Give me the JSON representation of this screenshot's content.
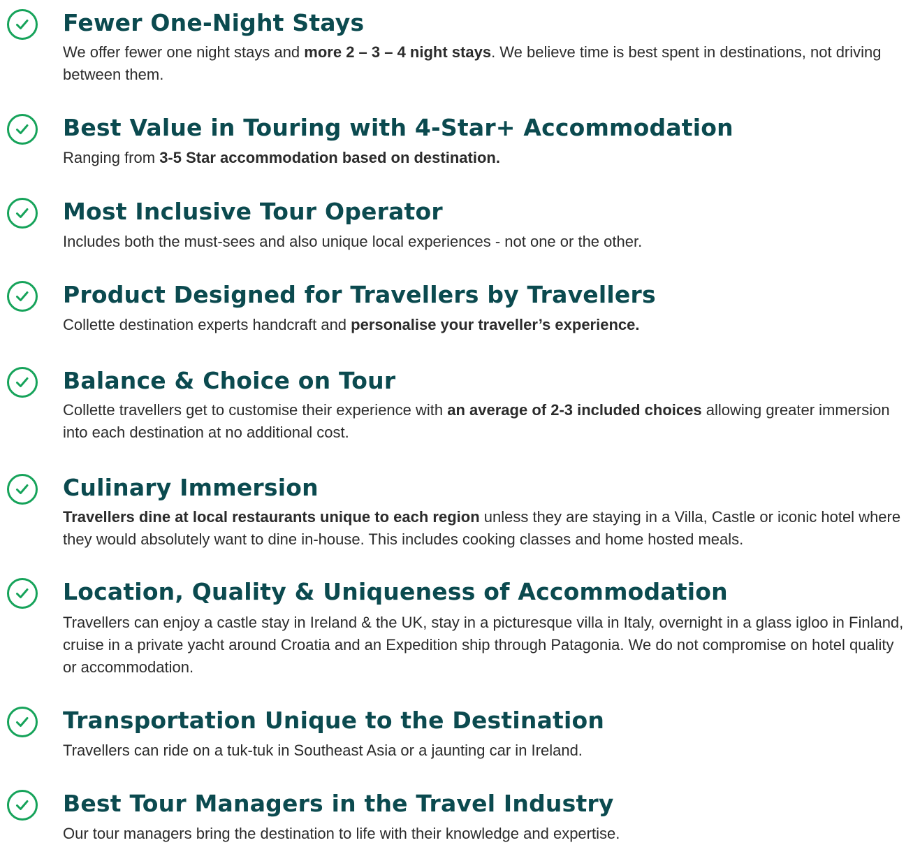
{
  "accent_color": "#16a35a",
  "heading_color": "#0b4a4f",
  "text_color": "#2b2b2b",
  "icon": "check-circle-icon",
  "items": [
    {
      "title": "Fewer One-Night Stays",
      "desc": [
        {
          "t": "We offer fewer one night stays and "
        },
        {
          "t": "more 2 – 3 – 4 night stays",
          "b": true
        },
        {
          "t": ". We believe time is best spent in destinations, not driving between them."
        }
      ]
    },
    {
      "title": "Best Value in Touring with 4-Star+ Accommodation",
      "desc": [
        {
          "t": "Ranging from "
        },
        {
          "t": "3-5 Star accommodation based on destination.",
          "b": true
        }
      ]
    },
    {
      "title": "Most Inclusive Tour Operator",
      "desc": [
        {
          "t": "Includes both the must-sees and also unique local experiences - not one or the other."
        }
      ]
    },
    {
      "title": "Product Designed for Travellers by Travellers",
      "desc": [
        {
          "t": "Collette destination experts handcraft and "
        },
        {
          "t": "personalise your traveller’s experience.",
          "b": true
        }
      ]
    },
    {
      "title": "Balance & Choice on Tour",
      "desc": [
        {
          "t": "Collette travellers get to customise their experience with "
        },
        {
          "t": "an average of 2-3 included choices",
          "b": true
        },
        {
          "t": " allowing greater immersion into each destination at no additional cost."
        }
      ]
    },
    {
      "title": "Culinary Immersion",
      "desc": [
        {
          "t": "Travellers dine at local restaurants unique to each region",
          "b": true
        },
        {
          "t": " unless they are staying in a Villa, Castle or iconic hotel where they would absolutely want to dine in-house. This includes cooking classes and home hosted meals."
        }
      ]
    },
    {
      "title": "Location, Quality & Uniqueness of Accommodation",
      "desc": [
        {
          "t": "Travellers can enjoy a castle stay in Ireland & the UK, stay in a picturesque villa in Italy, overnight in a glass igloo in Finland, cruise in a private yacht around Croatia and an Expedition ship through Patagonia. We do not compromise on hotel quality or accommodation."
        }
      ]
    },
    {
      "title": "Transportation Unique to the Destination",
      "desc": [
        {
          "t": "Travellers can ride on a tuk-tuk in Southeast Asia or a jaunting car in Ireland."
        }
      ]
    },
    {
      "title": "Best Tour Managers in the Travel Industry",
      "desc": [
        {
          "t": "Our tour managers bring the destination to life with their knowledge and expertise."
        }
      ]
    }
  ]
}
